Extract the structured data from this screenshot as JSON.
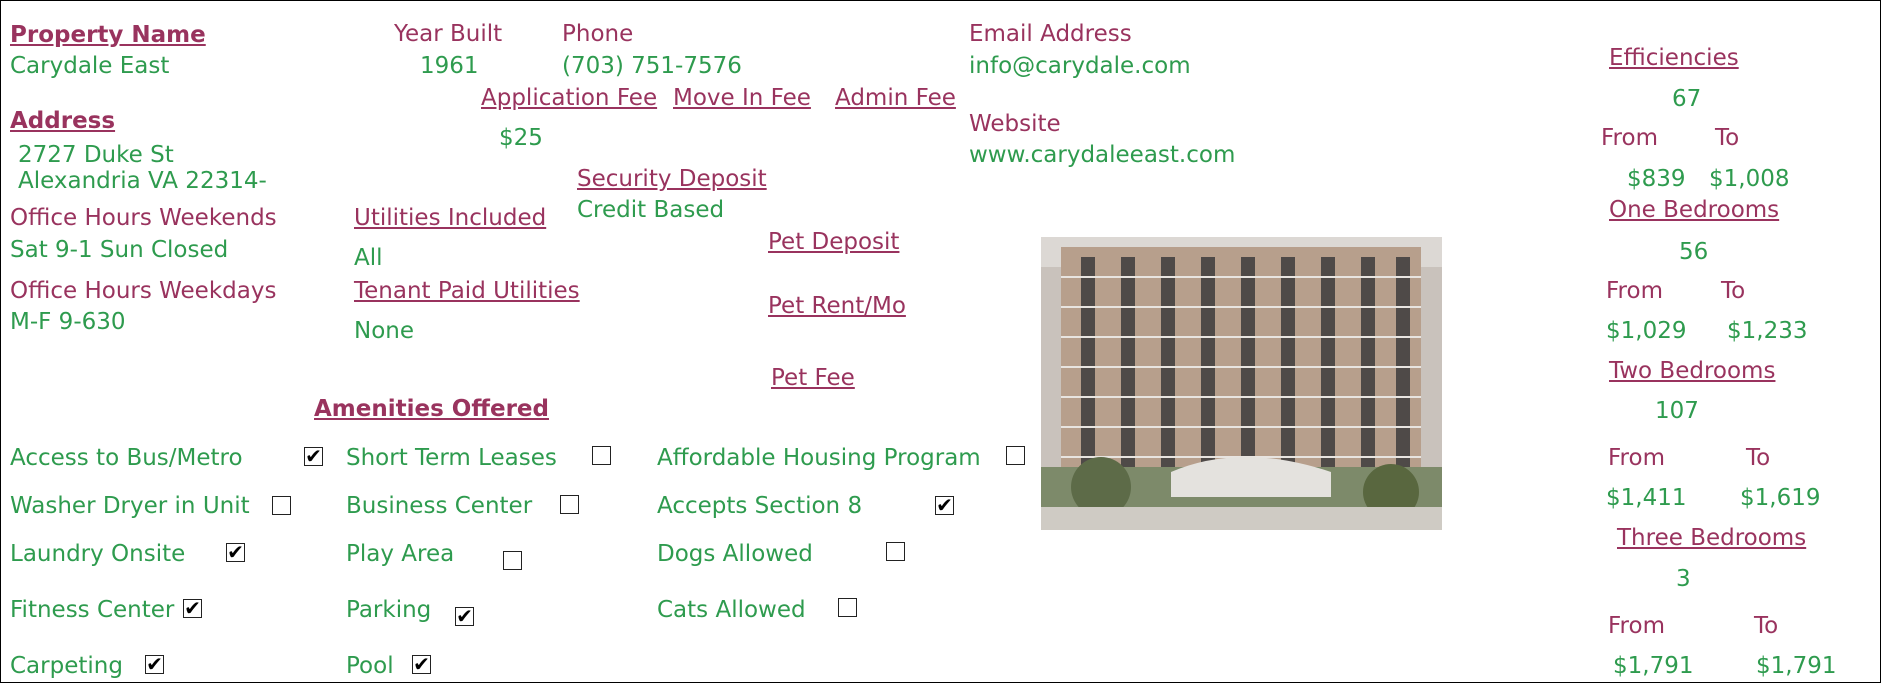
{
  "header": {
    "property_name_label": "Property Name",
    "property_name": "Carydale East",
    "year_built_label": "Year Built",
    "year_built": "1961",
    "phone_label": "Phone",
    "phone": "(703) 751-7576",
    "email_label": "Email Address",
    "email": "info@carydale.com",
    "website_label": "Website",
    "website": "www.carydaleeast.com"
  },
  "address": {
    "label": "Address",
    "line1": "2727 Duke St",
    "line2": "Alexandria VA 22314-"
  },
  "fees": {
    "application_label": "Application Fee",
    "application": "$25",
    "move_in_label": "Move In Fee",
    "admin_label": "Admin Fee",
    "security_label": "Security Deposit",
    "security": "Credit Based",
    "pet_deposit_label": "Pet Deposit",
    "pet_rent_label": "Pet Rent/Mo",
    "pet_fee_label": "Pet Fee"
  },
  "hours": {
    "weekends_label": "Office Hours Weekends",
    "weekends": "Sat 9-1  Sun Closed",
    "weekdays_label": "Office Hours Weekdays",
    "weekdays": "M-F 9-630"
  },
  "utilities": {
    "included_label": "Utilities Included",
    "included": "All",
    "tenant_paid_label": "Tenant Paid Utilities",
    "tenant_paid": "None"
  },
  "amenities": {
    "title": "Amenities Offered",
    "check_glyph": "✔",
    "items": [
      {
        "label": "Access to Bus/Metro",
        "checked": true
      },
      {
        "label": "Washer Dryer in Unit",
        "checked": false
      },
      {
        "label": "Laundry Onsite",
        "checked": true
      },
      {
        "label": "Fitness Center",
        "checked": true
      },
      {
        "label": "Carpeting",
        "checked": true
      },
      {
        "label": "Short Term Leases",
        "checked": false
      },
      {
        "label": "Business Center",
        "checked": false
      },
      {
        "label": "Play Area",
        "checked": false
      },
      {
        "label": "Parking",
        "checked": true
      },
      {
        "label": "Pool",
        "checked": true
      },
      {
        "label": "Affordable Housing Program",
        "checked": false
      },
      {
        "label": "Accepts Section 8",
        "checked": true
      },
      {
        "label": "Dogs Allowed",
        "checked": false
      },
      {
        "label": "Cats Allowed",
        "checked": false
      }
    ]
  },
  "units": {
    "from_label": "From",
    "to_label": "To",
    "efficiencies": {
      "label": "Efficiencies ",
      "count": "67",
      "from": "$839",
      "to": "$1,008"
    },
    "one_bed": {
      "label": "One Bedrooms",
      "count": "56",
      "from": "$1,029",
      "to": "$1,233"
    },
    "two_bed": {
      "label": "Two Bedrooms",
      "count": "107",
      "from": "$1,411",
      "to": "$1,619"
    },
    "three_bed": {
      "label": "Three Bedrooms",
      "count": "3",
      "from": "$1,791",
      "to": "$1,791"
    }
  },
  "colors": {
    "label": "#99335e",
    "value": "#2e9b4e"
  }
}
